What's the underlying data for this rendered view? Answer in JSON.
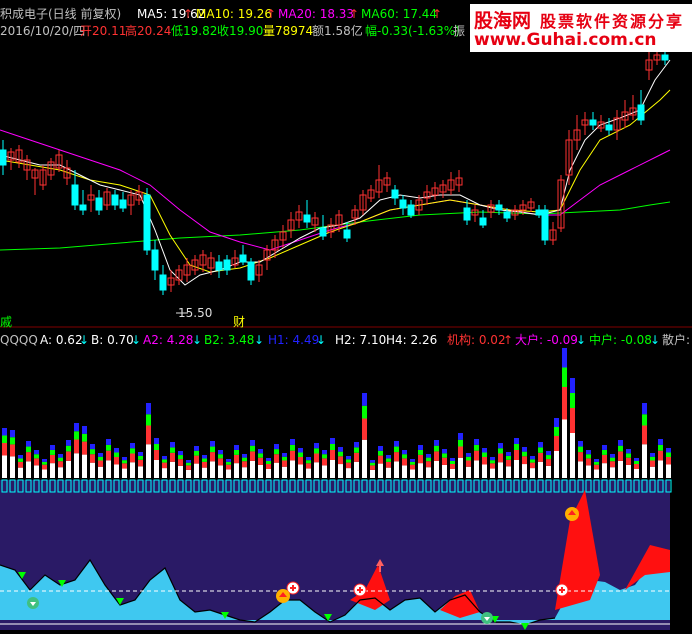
{
  "header": {
    "stock_name": "积成电子(日线 前复权)",
    "ma5": "MA5: 19.62",
    "ma10": "MA10: 19.26",
    "ma20": "MA20: 18.33",
    "ma60": "MA60: 17.44",
    "date": "2016/10/20/四",
    "open": "开20.11",
    "high": "高20.24",
    "low": "低19.82",
    "close": "收19.90",
    "volume": "量78974",
    "amount": "额1.58亿",
    "change": "幅-0.33(-1.63%)",
    "amplitude": "振"
  },
  "logo": {
    "name": "股海网",
    "slogan": "股票软件资源分享",
    "url": "www.Guhai.com.cn"
  },
  "price_chart": {
    "low_label": "15.50",
    "cai_marker": "财",
    "left_marker": "戚",
    "arrow_up": "↑"
  },
  "indicator_header": {
    "name": "QQQQ",
    "a": "A: 0.62",
    "b": "B: 0.70",
    "a2": "A2: 4.28",
    "b2": "B2: 3.48",
    "h1": "H1: 4.49",
    "h2": "H2: 7.10",
    "h4": "H4: 2.26",
    "jigou": "机构: 0.02",
    "dahu": "大户: -0.09",
    "zhonghu": "中户: -0.08",
    "sanhu": "散户:",
    "arrow_down": "↓",
    "arrow_up": "↑"
  },
  "colors": {
    "up": "#ff3232",
    "down": "#00ffff",
    "ma5": "#ffffff",
    "ma10": "#ffff00",
    "ma20": "#ff00ff",
    "ma60": "#00ff00",
    "panel_fill": "#2a1a66",
    "cyan_area": "#3fc8f0",
    "red_area": "#ff1010"
  }
}
